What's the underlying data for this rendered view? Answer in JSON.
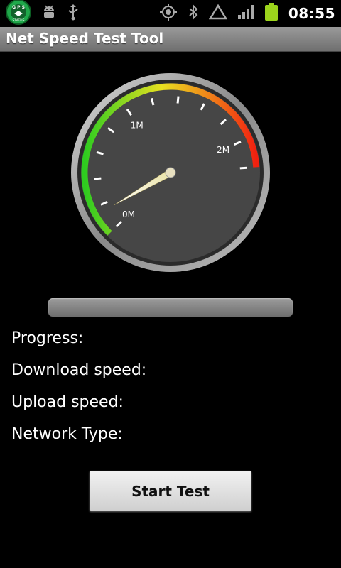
{
  "status_bar": {
    "time": "08:55",
    "icons_left": [
      "gps-status-app-icon",
      "android-debug-icon",
      "usb-icon"
    ],
    "icons_right": [
      "gps-icon",
      "bluetooth-icon",
      "signal-triangle-icon",
      "signal-bars-icon",
      "battery-icon"
    ],
    "app_badge_text": "G P S",
    "app_badge_subtext": "STATUS",
    "battery_color": "#9cd41c"
  },
  "app": {
    "title": "Net Speed Test Tool"
  },
  "gauge": {
    "labels": [
      "0M",
      "1M",
      "2M"
    ],
    "needle_value_mbps": 0.05,
    "max_mbps": 2.4,
    "colors": {
      "green": "#2ecc20",
      "yellow": "#e8e020",
      "red": "#f02010",
      "face": "#454545"
    }
  },
  "progress_bar": {
    "value_percent": 0
  },
  "info": {
    "progress_label": "Progress:",
    "download_label": "Download speed:",
    "upload_label": "Upload speed:",
    "network_label": "Network Type:"
  },
  "actions": {
    "start_label": "Start Test"
  }
}
